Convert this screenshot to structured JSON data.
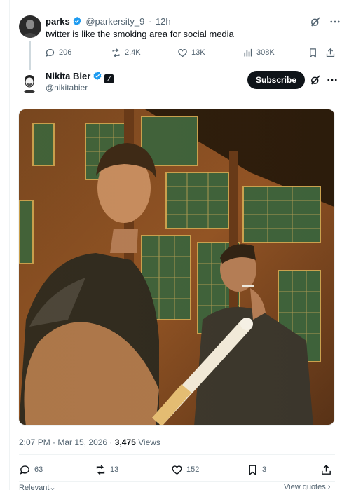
{
  "parent_tweet": {
    "name": "parks",
    "handle": "@parkersity_9",
    "separator": "·",
    "time": "12h",
    "text": "twitter is like the smoking area for social media",
    "replies": "206",
    "reposts": "2.4K",
    "likes": "13K",
    "views": "308K",
    "icons": [
      "grok-icon",
      "more-icon",
      "reply-icon",
      "repost-icon",
      "like-icon",
      "views-icon",
      "bookmark-icon",
      "share-icon"
    ]
  },
  "main_tweet": {
    "name": "Nikita Bier",
    "handle": "@nikitabier",
    "subscribe_label": "Subscribe",
    "time": "2:07 PM",
    "date": "Mar 15, 2026",
    "views_count": "3,475",
    "views_label": "Views",
    "replies": "63",
    "reposts": "13",
    "likes": "152",
    "bookmarks": "3"
  },
  "footer": {
    "left_label": "Relevant",
    "right_label": "View quotes"
  },
  "colors": {
    "verified": "#1d9bf0",
    "text": "#0f1419",
    "secondary": "#536471",
    "divider": "#eff3f4"
  }
}
